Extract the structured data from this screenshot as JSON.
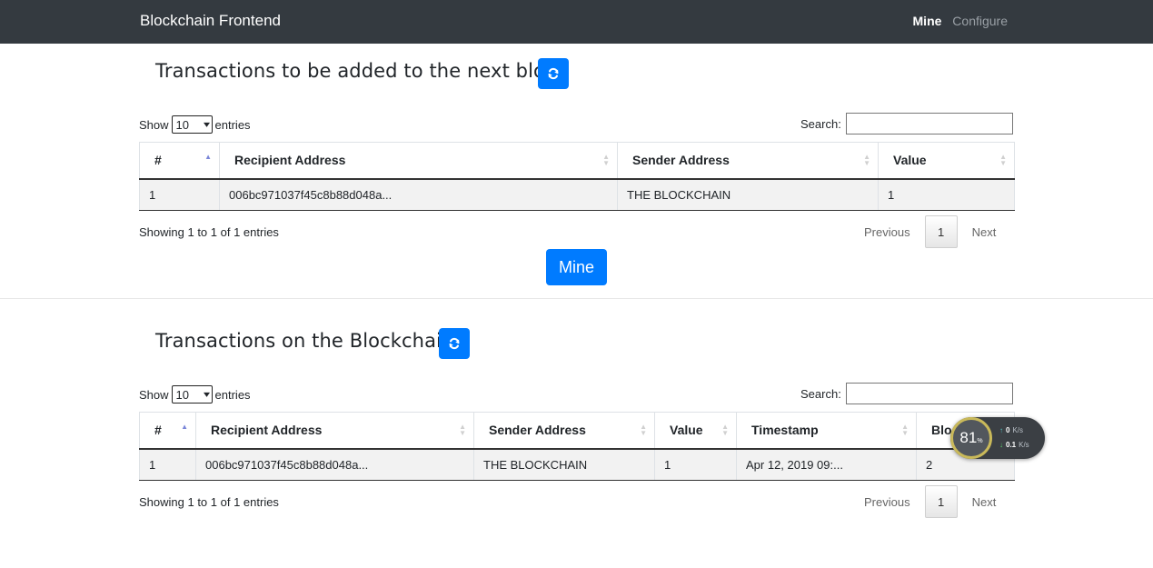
{
  "nav": {
    "brand": "Blockchain Frontend",
    "links": [
      "Mine",
      "Configure"
    ]
  },
  "pending": {
    "title": "Transactions to be added to the next block",
    "show_prefix": "Show",
    "show_value": "10",
    "show_suffix": "entries",
    "search_label": "Search:",
    "search_value": "",
    "columns": [
      "#",
      "Recipient Address",
      "Sender Address",
      "Value"
    ],
    "rows": [
      [
        "1",
        "006bc971037f45c8b88d048a...",
        "THE BLOCKCHAIN",
        "1"
      ]
    ],
    "info": "Showing 1 to 1 of 1 entries",
    "pagination": {
      "previous": "Previous",
      "page": "1",
      "next": "Next"
    },
    "mine_button": "Mine"
  },
  "chain": {
    "title": "Transactions on the Blockchain",
    "show_prefix": "Show",
    "show_value": "10",
    "show_suffix": "entries",
    "search_label": "Search:",
    "search_value": "",
    "columns": [
      "#",
      "Recipient Address",
      "Sender Address",
      "Value",
      "Timestamp",
      "Block"
    ],
    "rows": [
      [
        "1",
        "006bc971037f45c8b88d048a...",
        "THE BLOCKCHAIN",
        "1",
        "Apr 12, 2019 09:...",
        "2"
      ]
    ],
    "info": "Showing 1 to 1 of 1 entries",
    "pagination": {
      "previous": "Previous",
      "page": "1",
      "next": "Next"
    }
  },
  "overlay_widget": {
    "percent": "81",
    "percent_unit": "%",
    "up_value": "0",
    "down_value": "0.1",
    "unit": "K/s"
  },
  "colors": {
    "navbar": "#343a40",
    "primary": "#007bff"
  }
}
